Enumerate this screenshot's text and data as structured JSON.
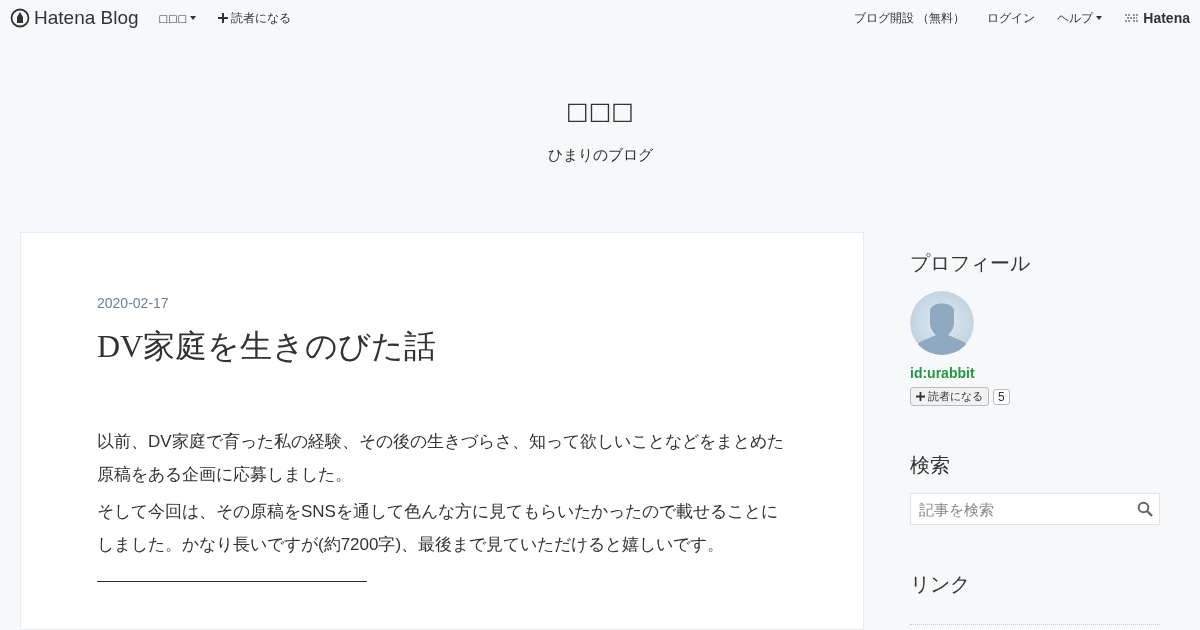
{
  "topbar": {
    "logo": "Hatena Blog",
    "menu": "□□□",
    "subscribe": "読者になる",
    "links": [
      {
        "label": "ブログ開設 （無料）",
        "dropdown": false
      },
      {
        "label": "ログイン",
        "dropdown": false
      },
      {
        "label": "ヘルプ",
        "dropdown": true
      }
    ],
    "brand": "Hatena"
  },
  "blog": {
    "title": "□□□",
    "subtitle": "ひまりのブログ"
  },
  "article": {
    "date": "2020-02-17",
    "title": "DV家庭を生きのびた話",
    "paragraphs": [
      "以前、DV家庭で育った私の経験、その後の生きづらさ、知って欲しいことなどをまとめた原稿をある企画に応募しました。",
      "そして今回は、その原稿をSNSを通して色んな方に見てもらいたかったので載せることにしました。かなり長いですが(約7200字)、最後まで見ていただけると嬉しいです。"
    ]
  },
  "sidebar": {
    "profile": {
      "heading": "プロフィール",
      "user": "id:urabbit",
      "subscribe": "読者になる",
      "count": "5"
    },
    "search": {
      "heading": "検索",
      "placeholder": "記事を検索"
    },
    "links": {
      "heading": "リンク"
    }
  }
}
